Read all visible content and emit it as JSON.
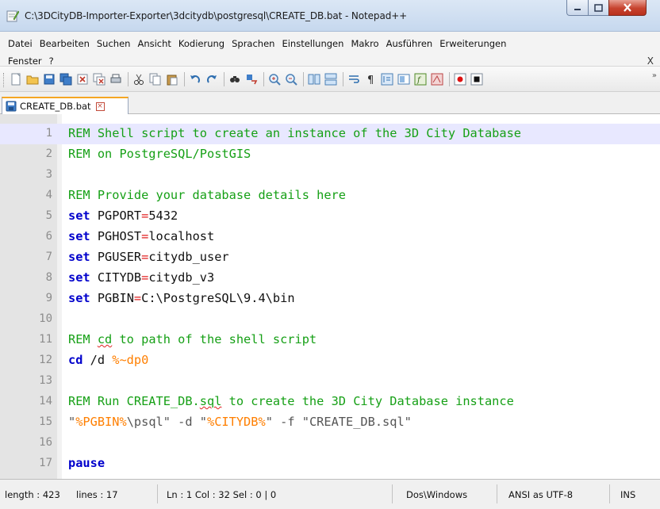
{
  "window": {
    "title": "C:\\3DCityDB-Importer-Exporter\\3dcitydb\\postgresql\\CREATE_DB.bat - Notepad++"
  },
  "menu": {
    "row1": [
      "Datei",
      "Bearbeiten",
      "Suchen",
      "Ansicht",
      "Kodierung",
      "Sprachen",
      "Einstellungen",
      "Makro",
      "Ausführen",
      "Erweiterungen"
    ],
    "row2": [
      "Fenster",
      "?"
    ],
    "close_label": "X"
  },
  "toolbar": {
    "icons": [
      "new-file-icon",
      "open-file-icon",
      "save-icon",
      "save-all-icon",
      "close-icon",
      "close-all-icon",
      "print-icon",
      "cut-icon",
      "copy-icon",
      "paste-icon",
      "undo-icon",
      "redo-icon",
      "find-icon",
      "replace-icon",
      "zoom-in-icon",
      "zoom-out-icon",
      "sync-vertical-icon",
      "sync-horizontal-icon",
      "word-wrap-icon",
      "show-all-chars-icon",
      "indent-guide-icon",
      "doc-map-icon",
      "function-list-icon",
      "folder-as-workspace-icon",
      "record-macro-icon",
      "stop-macro-icon"
    ],
    "overflow": "»"
  },
  "tab": {
    "label": "CREATE_DB.bat",
    "close": "×"
  },
  "editor": {
    "current_line": 1,
    "lines": [
      {
        "n": "1"
      },
      {
        "n": "2"
      },
      {
        "n": "3"
      },
      {
        "n": "4"
      },
      {
        "n": "5"
      },
      {
        "n": "6"
      },
      {
        "n": "7"
      },
      {
        "n": "8"
      },
      {
        "n": "9"
      },
      {
        "n": "10"
      },
      {
        "n": "11"
      },
      {
        "n": "12"
      },
      {
        "n": "13"
      },
      {
        "n": "14"
      },
      {
        "n": "15"
      },
      {
        "n": "16"
      },
      {
        "n": "17"
      }
    ],
    "code": {
      "l1": "REM Shell script to create an instance of the 3D City Database",
      "l2": "REM on PostgreSQL/PostGIS",
      "l4": "REM Provide your database details here",
      "l5_kw": "set",
      "l5_var": " PGPORT",
      "l5_op": "=",
      "l5_val": "5432",
      "l6_kw": "set",
      "l6_var": " PGHOST",
      "l6_op": "=",
      "l6_val": "localhost",
      "l7_kw": "set",
      "l7_var": " PGUSER",
      "l7_op": "=",
      "l7_val": "citydb_user",
      "l8_kw": "set",
      "l8_var": " CITYDB",
      "l8_op": "=",
      "l8_val": "citydb_v3",
      "l9_kw": "set",
      "l9_var": " PGBIN",
      "l9_op": "=",
      "l9_val": "C:\\PostgreSQL\\9.4\\bin",
      "l11_a": "REM ",
      "l11_b": "cd",
      "l11_c": " to path of the shell script",
      "l12_kw": "cd",
      "l12_txt": " /d ",
      "l12_var": "%~dp0",
      "l14_a": "REM Run CREATE_DB.",
      "l14_b": "sql",
      "l14_c": " to create the 3D City Database instance",
      "l15_q1": "\"",
      "l15_v1": "%PGBIN%",
      "l15_s1": "\\psql\" -d \"",
      "l15_v2": "%CITYDB%",
      "l15_s2": "\" -f \"CREATE_DB.sql\"",
      "l17_kw": "pause"
    }
  },
  "status": {
    "length": "length : 423",
    "lines": "lines : 17",
    "position": "Ln : 1    Col : 32    Sel : 0 | 0",
    "eol": "Dos\\Windows",
    "encoding": "ANSI as UTF-8",
    "mode": "INS"
  }
}
